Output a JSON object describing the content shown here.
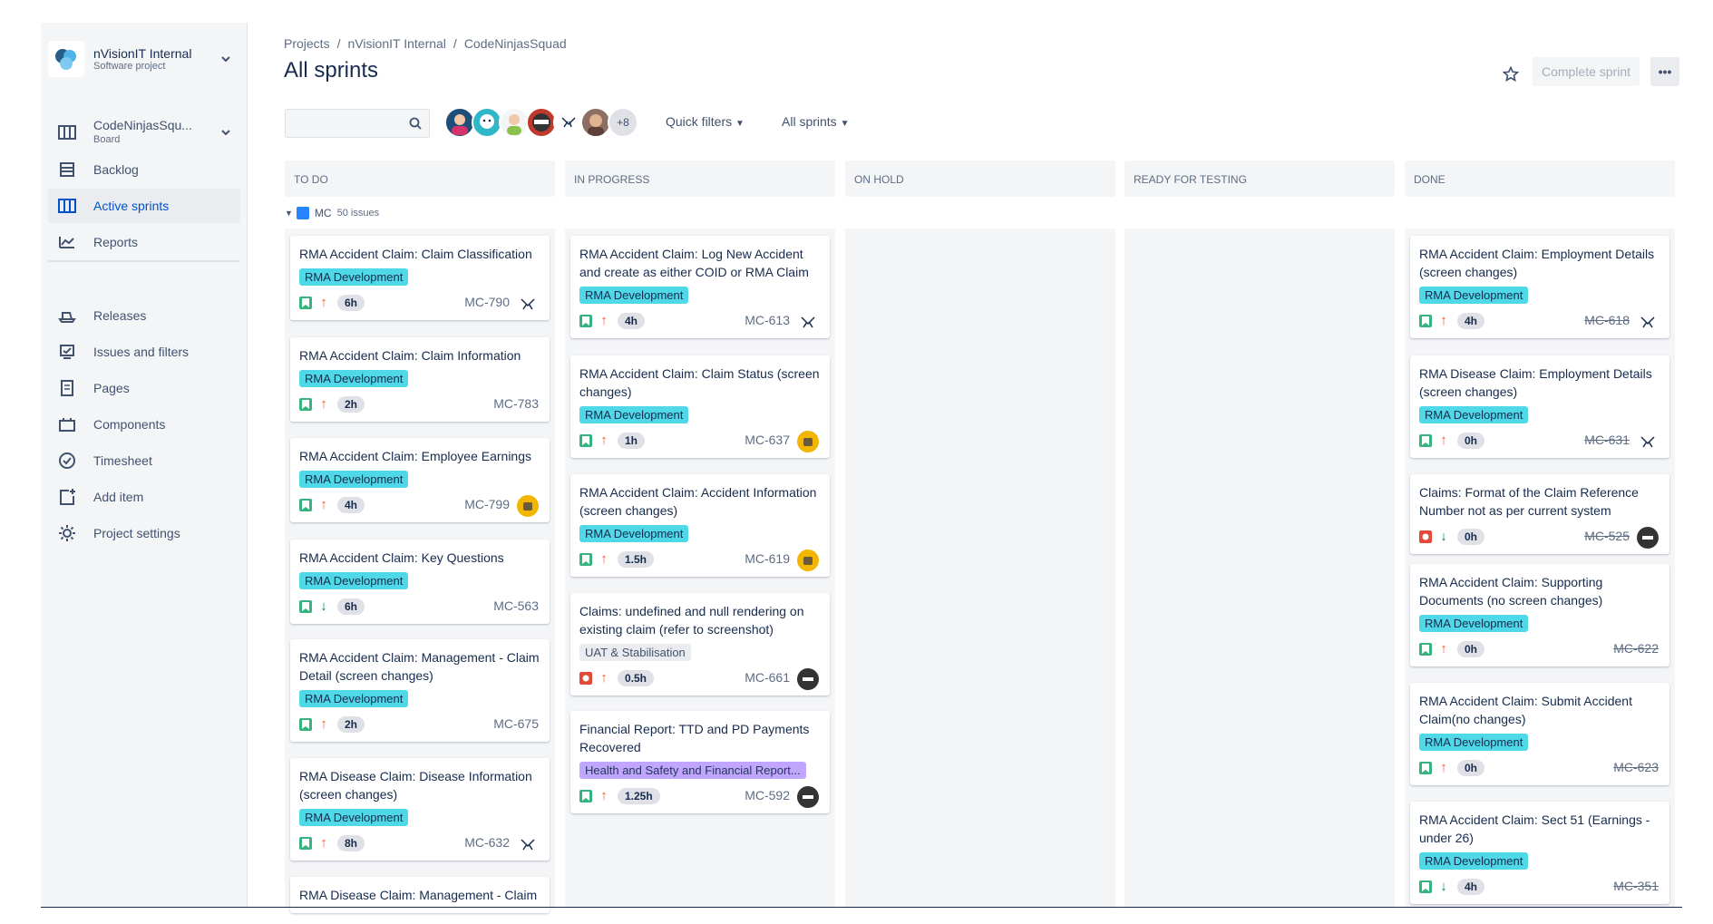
{
  "sidebar": {
    "project_name": "nVisionIT Internal",
    "project_type": "Software project",
    "board_name": "CodeNinjasSqu...",
    "board_type": "Board",
    "nav": [
      {
        "label": "Backlog",
        "icon": "backlog-icon"
      },
      {
        "label": "Active sprints",
        "icon": "board-columns-icon"
      },
      {
        "label": "Reports",
        "icon": "chart-line-icon"
      }
    ],
    "nav2": [
      {
        "label": "Releases",
        "icon": "ship-icon"
      },
      {
        "label": "Issues and filters",
        "icon": "issues-icon"
      },
      {
        "label": "Pages",
        "icon": "page-icon"
      },
      {
        "label": "Components",
        "icon": "component-icon"
      },
      {
        "label": "Timesheet",
        "icon": "check-circle-icon"
      },
      {
        "label": "Add item",
        "icon": "add-item-icon"
      },
      {
        "label": "Project settings",
        "icon": "gear-icon"
      }
    ]
  },
  "header": {
    "breadcrumb": [
      "Projects",
      "nVisionIT Internal",
      "CodeNinjasSquad"
    ],
    "title": "All sprints",
    "complete_sprint": "Complete sprint",
    "avatar_more": "+8",
    "quick_filters": "Quick filters",
    "all_sprints": "All sprints"
  },
  "columns": [
    "TO DO",
    "IN PROGRESS",
    "ON HOLD",
    "READY FOR TESTING",
    "DONE"
  ],
  "swimlane": {
    "name": "MC",
    "count": "50 issues"
  },
  "cards": {
    "todo": [
      {
        "title": "RMA Accident Claim: Claim Classification",
        "label": "RMA Development",
        "est": "6h",
        "key": "MC-790"
      },
      {
        "title": "RMA Accident Claim: Claim Information",
        "label": "RMA Development",
        "est": "2h",
        "key": "MC-783"
      },
      {
        "title": "RMA Accident Claim: Employee Earnings",
        "label": "RMA Development",
        "est": "4h",
        "key": "MC-799"
      },
      {
        "title": "RMA Accident Claim: Key Questions",
        "label": "RMA Development",
        "est": "6h",
        "key": "MC-563"
      },
      {
        "title": "RMA Accident Claim: Management - Claim Detail (screen changes)",
        "label": "RMA Development",
        "est": "2h",
        "key": "MC-675"
      },
      {
        "title": "RMA Disease Claim: Disease Information (screen changes)",
        "label": "RMA Development",
        "est": "8h",
        "key": "MC-632"
      },
      {
        "title": "RMA Disease Claim: Management - Claim"
      }
    ],
    "inprogress": [
      {
        "title": "RMA Accident Claim: Log New Accident and create as either COID or RMA Claim",
        "label": "RMA Development",
        "est": "4h",
        "key": "MC-613"
      },
      {
        "title": "RMA Accident Claim: Claim Status (screen changes)",
        "label": "RMA Development",
        "est": "1h",
        "key": "MC-637"
      },
      {
        "title": "RMA Accident Claim: Accident Information (screen changes)",
        "label": "RMA Development",
        "est": "1.5h",
        "key": "MC-619"
      },
      {
        "title": "Claims: undefined and null rendering on existing claim (refer to screenshot)",
        "label": "UAT & Stabilisation",
        "est": "0.5h",
        "key": "MC-661"
      },
      {
        "title": "Financial Report: TTD and PD Payments Recovered",
        "label": "Health and Safety and Financial Report...",
        "est": "1.25h",
        "key": "MC-592"
      }
    ],
    "done": [
      {
        "title": "RMA Accident Claim: Employment Details (screen changes)",
        "label": "RMA Development",
        "est": "4h",
        "key": "MC-618"
      },
      {
        "title": "RMA Disease Claim: Employment Details (screen changes)",
        "label": "RMA Development",
        "est": "0h",
        "key": "MC-631"
      },
      {
        "title": "Claims: Format of the Claim Reference Number not as per current system",
        "est": "0h",
        "key": "MC-525"
      },
      {
        "title": "RMA Accident Claim: Supporting Documents (no screen changes)",
        "label": "RMA Development",
        "est": "0h",
        "key": "MC-622"
      },
      {
        "title": "RMA Accident Claim: Submit Accident Claim(no changes)",
        "label": "RMA Development",
        "est": "0h",
        "key": "MC-623"
      },
      {
        "title": "RMA Accident Claim: Sect 51 (Earnings - under 26)",
        "label": "RMA Development",
        "est": "4h",
        "key": "MC-351"
      }
    ]
  },
  "colors": {
    "accent": "#0052cc",
    "label_rma": "#4fd9e8",
    "label_hsf": "#c0a6ff",
    "story": "#36b37e",
    "bug": "#e5493a"
  }
}
